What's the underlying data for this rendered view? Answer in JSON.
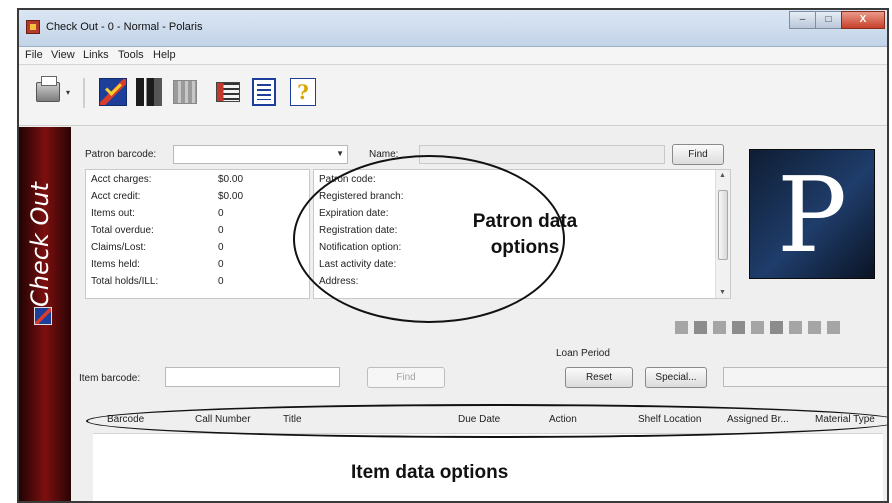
{
  "window": {
    "title": "Check Out - 0 - Normal - Polaris",
    "controls": [
      "–",
      "□",
      "X"
    ]
  },
  "menu": [
    "File",
    "View",
    "Links",
    "Tools",
    "Help"
  ],
  "toolbar": {
    "dropdown_arrow": "▾",
    "help_glyph": "?"
  },
  "sidebar": {
    "title": "Check Out"
  },
  "patron": {
    "barcode_label": "Patron barcode:",
    "barcode_value": "",
    "name_label": "Name:",
    "name_value": "",
    "find_label": "Find",
    "stats": [
      {
        "label": "Acct charges:",
        "value": "$0.00"
      },
      {
        "label": "Acct credit:",
        "value": "$0.00"
      },
      {
        "label": "Items out:",
        "value": "0"
      },
      {
        "label": "Total overdue:",
        "value": "0"
      },
      {
        "label": "Claims/Lost:",
        "value": "0"
      },
      {
        "label": "Items held:",
        "value": "0"
      },
      {
        "label": "Total holds/ILL:",
        "value": "0"
      }
    ],
    "details": [
      "Patron code:",
      "Registered branch:",
      "Expiration date:",
      "Registration date:",
      "Notification option:",
      "Last activity date:",
      "Address:"
    ],
    "photo_letter": "P"
  },
  "item": {
    "barcode_label": "Item barcode:",
    "barcode_value": "",
    "find_label": "Find",
    "loan_period_label": "Loan Period",
    "reset_label": "Reset",
    "special_label": "Special...",
    "columns": [
      "Barcode",
      "Call Number",
      "Title",
      "Due Date",
      "Action",
      "Shelf Location",
      "Assigned Br...",
      "Material Type"
    ]
  },
  "annotations": {
    "patron_line1": "Patron data",
    "patron_line2": "options",
    "item": "Item data options"
  }
}
